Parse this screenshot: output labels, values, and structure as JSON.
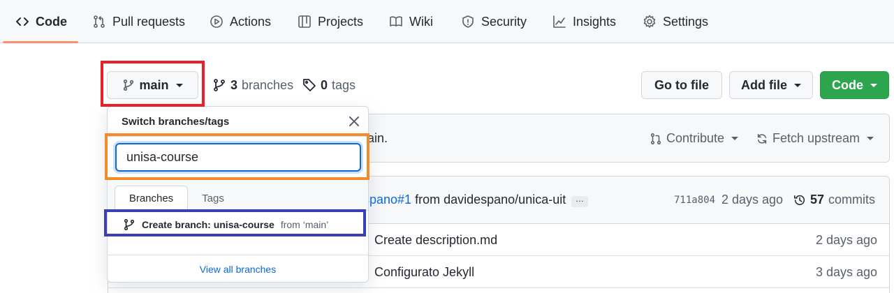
{
  "nav": {
    "tabs": [
      {
        "label": "Code",
        "icon": "code-icon",
        "selected": true
      },
      {
        "label": "Pull requests",
        "icon": "git-pull-request-icon"
      },
      {
        "label": "Actions",
        "icon": "play-icon"
      },
      {
        "label": "Projects",
        "icon": "table-icon"
      },
      {
        "label": "Wiki",
        "icon": "book-icon"
      },
      {
        "label": "Security",
        "icon": "shield-icon"
      },
      {
        "label": "Insights",
        "icon": "graph-icon"
      },
      {
        "label": "Settings",
        "icon": "gear-icon"
      }
    ]
  },
  "repo": {
    "branch_button": "main",
    "branches_count": "3",
    "branches_label": "branches",
    "tags_count": "0",
    "tags_label": "tags",
    "go_to_file": "Go to file",
    "add_file": "Add file",
    "code_button": "Code"
  },
  "fork_bar": {
    "partial_text": "ain.",
    "contribute": "Contribute",
    "fetch_upstream": "Fetch upstream"
  },
  "commit": {
    "partial_link": "spano#1",
    "from_text": "from davidespano/unica-uit",
    "ellipsis": "…",
    "hash": "711a804",
    "time": "2 days ago",
    "commits_count": "57",
    "commits_label": "commits"
  },
  "files": [
    {
      "message": "Create description.md",
      "time": "2 days ago"
    },
    {
      "message": "Configurato Jekyll",
      "time": "3 days ago"
    }
  ],
  "dropdown": {
    "title": "Switch branches/tags",
    "filter_value": "unisa-course",
    "tabs": [
      "Branches",
      "Tags"
    ],
    "create_prefix": "Create branch: unisa-course",
    "create_suffix": "from ‘main’",
    "footer": "View all branches"
  },
  "colors": {
    "accent_blue": "#0969da",
    "green": "#2da44e",
    "annotation_red": "#e8202a",
    "annotation_orange": "#f28c28",
    "annotation_blue": "#3a3fb8"
  }
}
